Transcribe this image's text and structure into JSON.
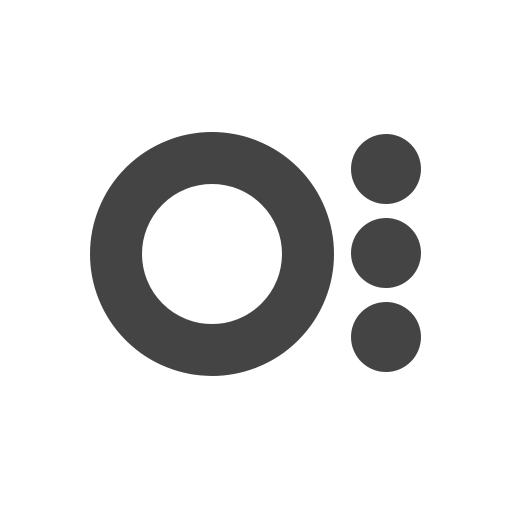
{
  "logo": {
    "icon_name": "ring-with-three-dots-logo",
    "mark_color": "#444444",
    "background_color": "#ffffff",
    "dot_count": 3
  }
}
